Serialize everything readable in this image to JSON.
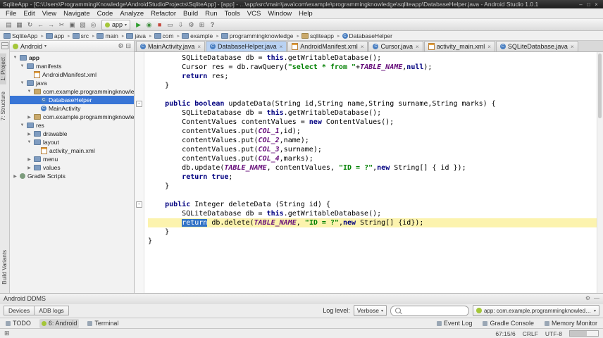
{
  "window": {
    "title": "SqliteApp - [C:\\Users\\ProgrammingKnowledge\\AndroidStudioProjects\\SqliteApp] - [app] - ...\\app\\src\\main\\java\\com\\example\\programmingknowledge\\sqliteapp\\DatabaseHelper.java - Android Studio 1.0.1"
  },
  "menu_bar": [
    "File",
    "Edit",
    "View",
    "Navigate",
    "Code",
    "Analyze",
    "Refactor",
    "Build",
    "Run",
    "Tools",
    "VCS",
    "Window",
    "Help"
  ],
  "toolbar": {
    "run_config": "app",
    "icons_left": [
      "open",
      "save",
      "sync",
      "back",
      "forward",
      "cut",
      "copy",
      "paste",
      "find"
    ],
    "icons_right": [
      "run",
      "debug",
      "stop",
      "avd-manager",
      "sdk-manager",
      "settings",
      "project-structure",
      "help"
    ]
  },
  "breadcrumbs": [
    {
      "label": "SqliteApp",
      "icon": "project"
    },
    {
      "label": "app",
      "icon": "module"
    },
    {
      "label": "src",
      "icon": "folder"
    },
    {
      "label": "main",
      "icon": "folder"
    },
    {
      "label": "java",
      "icon": "folder"
    },
    {
      "label": "com",
      "icon": "folder"
    },
    {
      "label": "example",
      "icon": "folder"
    },
    {
      "label": "programmingknowledge",
      "icon": "folder"
    },
    {
      "label": "sqliteapp",
      "icon": "package"
    },
    {
      "label": "DatabaseHelper",
      "icon": "class"
    }
  ],
  "left_strip": {
    "top": [
      {
        "label": "1: Project",
        "active": true
      },
      {
        "label": "7: Structure",
        "active": false
      }
    ],
    "bottom": [
      {
        "label": "Build Variants",
        "active": false
      }
    ]
  },
  "project_panel": {
    "view_selector": "Android",
    "tree": [
      {
        "label": "app",
        "indent": 0,
        "icon": "folder",
        "arrow": "down",
        "bold": true,
        "selected": false
      },
      {
        "label": "manifests",
        "indent": 1,
        "icon": "folder",
        "arrow": "down",
        "bold": false,
        "selected": false
      },
      {
        "label": "AndroidManifest.xml",
        "indent": 2,
        "icon": "xml",
        "arrow": "none",
        "bold": false,
        "selected": false
      },
      {
        "label": "java",
        "indent": 1,
        "icon": "folder",
        "arrow": "down",
        "bold": false,
        "selected": false
      },
      {
        "label": "com.example.programmingknowledge.sqliteapp",
        "indent": 2,
        "icon": "package",
        "arrow": "down",
        "bold": false,
        "selected": false
      },
      {
        "label": "DatabaseHelper",
        "indent": 3,
        "icon": "class",
        "arrow": "none",
        "bold": false,
        "selected": true
      },
      {
        "label": "MainActivity",
        "indent": 3,
        "icon": "class",
        "arrow": "none",
        "bold": false,
        "selected": false
      },
      {
        "label": "com.example.programmingknowledge.sqliteapp",
        "indent": 2,
        "icon": "package",
        "arrow": "right",
        "bold": false,
        "selected": false
      },
      {
        "label": "res",
        "indent": 1,
        "icon": "folder",
        "arrow": "down",
        "bold": false,
        "selected": false
      },
      {
        "label": "drawable",
        "indent": 2,
        "icon": "folder",
        "arrow": "right",
        "bold": false,
        "selected": false
      },
      {
        "label": "layout",
        "indent": 2,
        "icon": "folder",
        "arrow": "down",
        "bold": false,
        "selected": false
      },
      {
        "label": "activity_main.xml",
        "indent": 3,
        "icon": "xml",
        "arrow": "none",
        "bold": false,
        "selected": false
      },
      {
        "label": "menu",
        "indent": 2,
        "icon": "folder",
        "arrow": "right",
        "bold": false,
        "selected": false
      },
      {
        "label": "values",
        "indent": 2,
        "icon": "folder",
        "arrow": "right",
        "bold": false,
        "selected": false
      },
      {
        "label": "Gradle Scripts",
        "indent": 0,
        "icon": "gradle",
        "arrow": "right",
        "bold": false,
        "selected": false
      }
    ]
  },
  "editor": {
    "tabs": [
      {
        "label": "MainActivity.java",
        "icon": "java",
        "active": false
      },
      {
        "label": "DatabaseHelper.java",
        "icon": "java",
        "active": true
      },
      {
        "label": "AndroidManifest.xml",
        "icon": "xml",
        "active": false
      },
      {
        "label": "Cursor.java",
        "icon": "java",
        "active": false
      },
      {
        "label": "activity_main.xml",
        "icon": "xml",
        "active": false
      },
      {
        "label": "SQLiteDatabase.java",
        "icon": "java",
        "active": false
      }
    ],
    "fold_lines": [
      6,
      17
    ],
    "lines": [
      {
        "hl": false,
        "segs": [
          [
            "p",
            "        SQLiteDatabase db = "
          ],
          [
            "k",
            "this"
          ],
          [
            "p",
            ".getWritableDatabase();"
          ]
        ]
      },
      {
        "hl": false,
        "segs": [
          [
            "p",
            "        Cursor res = db.rawQuery("
          ],
          [
            "s",
            "\"select * from \""
          ],
          [
            "p",
            "+"
          ],
          [
            "f",
            "TABLE_NAME"
          ],
          [
            "p",
            ","
          ],
          [
            "k",
            "null"
          ],
          [
            "p",
            ");"
          ]
        ]
      },
      {
        "hl": false,
        "segs": [
          [
            "p",
            "        "
          ],
          [
            "k",
            "return"
          ],
          [
            "p",
            " res;"
          ]
        ]
      },
      {
        "hl": false,
        "segs": [
          [
            "p",
            "    }"
          ]
        ]
      },
      {
        "hl": false,
        "segs": [
          [
            "p",
            ""
          ]
        ]
      },
      {
        "hl": false,
        "segs": [
          [
            "p",
            "    "
          ],
          [
            "k",
            "public boolean"
          ],
          [
            "p",
            " updateData(String id,String name,String surname,String marks) {"
          ]
        ]
      },
      {
        "hl": false,
        "segs": [
          [
            "p",
            "        SQLiteDatabase db = "
          ],
          [
            "k",
            "this"
          ],
          [
            "p",
            ".getWritableDatabase();"
          ]
        ]
      },
      {
        "hl": false,
        "segs": [
          [
            "p",
            "        ContentValues contentValues = "
          ],
          [
            "k",
            "new"
          ],
          [
            "p",
            " ContentValues();"
          ]
        ]
      },
      {
        "hl": false,
        "segs": [
          [
            "p",
            "        contentValues.put("
          ],
          [
            "f",
            "COL_1"
          ],
          [
            "p",
            ",id);"
          ]
        ]
      },
      {
        "hl": false,
        "segs": [
          [
            "p",
            "        contentValues.put("
          ],
          [
            "f",
            "COL_2"
          ],
          [
            "p",
            ",name);"
          ]
        ]
      },
      {
        "hl": false,
        "segs": [
          [
            "p",
            "        contentValues.put("
          ],
          [
            "f",
            "COL_3"
          ],
          [
            "p",
            ",surname);"
          ]
        ]
      },
      {
        "hl": false,
        "segs": [
          [
            "p",
            "        contentValues.put("
          ],
          [
            "f",
            "COL_4"
          ],
          [
            "p",
            ",marks);"
          ]
        ]
      },
      {
        "hl": false,
        "segs": [
          [
            "p",
            "        db.update("
          ],
          [
            "f",
            "TABLE_NAME"
          ],
          [
            "p",
            ", contentValues, "
          ],
          [
            "s",
            "\"ID = ?\""
          ],
          [
            "p",
            ","
          ],
          [
            "k",
            "new"
          ],
          [
            "p",
            " String[] { id });"
          ]
        ]
      },
      {
        "hl": false,
        "segs": [
          [
            "p",
            "        "
          ],
          [
            "k",
            "return true"
          ],
          [
            "p",
            ";"
          ]
        ]
      },
      {
        "hl": false,
        "segs": [
          [
            "p",
            "    }"
          ]
        ]
      },
      {
        "hl": false,
        "segs": [
          [
            "p",
            ""
          ]
        ]
      },
      {
        "hl": false,
        "segs": [
          [
            "p",
            "    "
          ],
          [
            "k",
            "public"
          ],
          [
            "p",
            " Integer deleteData (String id) {"
          ]
        ]
      },
      {
        "hl": false,
        "segs": [
          [
            "p",
            "        SQLiteDatabase db = "
          ],
          [
            "k",
            "this"
          ],
          [
            "p",
            ".getWritableDatabase();"
          ]
        ]
      },
      {
        "hl": true,
        "segs": [
          [
            "p",
            "        "
          ],
          [
            "sel",
            "return"
          ],
          [
            "p",
            " db.delete("
          ],
          [
            "f",
            "TABLE_NAME"
          ],
          [
            "p",
            ", "
          ],
          [
            "s",
            "\"ID = ?\""
          ],
          [
            "p",
            ","
          ],
          [
            "k",
            "new"
          ],
          [
            "p",
            " String[] {id});"
          ]
        ]
      },
      {
        "hl": false,
        "segs": [
          [
            "p",
            "    }"
          ]
        ]
      },
      {
        "hl": false,
        "segs": [
          [
            "p",
            "}"
          ]
        ]
      }
    ]
  },
  "ddms": {
    "title": "Android DDMS",
    "tabs": [
      "Devices",
      "ADB logs"
    ],
    "log_level_label": "Log level:",
    "log_level_value": "Verbose",
    "search_value": "",
    "app_selector": "app: com.example.programmingknowledge.sqliteapp"
  },
  "tool_buttons": {
    "left": [
      {
        "label": "TODO",
        "icon": "todo",
        "active": false
      },
      {
        "label": "6: Android",
        "icon": "android",
        "active": true
      },
      {
        "label": "Terminal",
        "icon": "terminal",
        "active": false
      }
    ],
    "right": [
      {
        "label": "Event Log",
        "icon": "event-log",
        "active": false
      },
      {
        "label": "Gradle Console",
        "icon": "gradle-console",
        "active": false
      },
      {
        "label": "Memory Monitor",
        "icon": "memory-monitor",
        "active": false
      }
    ]
  },
  "status_bar": {
    "position": "67:15/6",
    "line_ending": "CRLF",
    "encoding": "UTF-8"
  }
}
